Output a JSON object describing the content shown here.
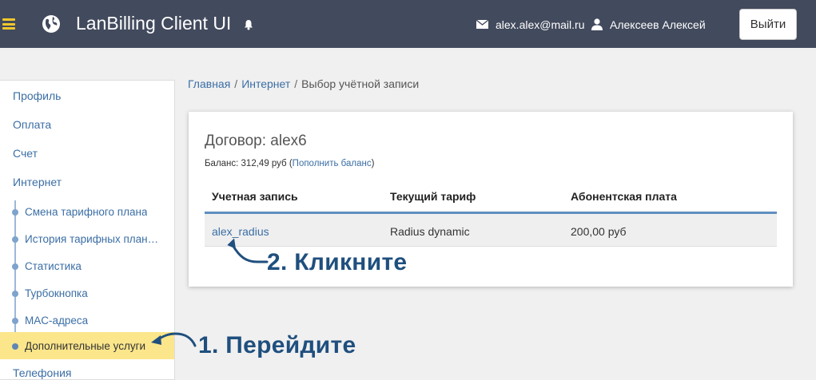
{
  "header": {
    "app_title": "LanBilling Client UI",
    "email": "alex.alex@mail.ru",
    "username": "Алексеев Алексей",
    "logout_label": "Выйти",
    "accent_color": "#f3c82a",
    "bg_color": "#424a5d"
  },
  "sidebar": {
    "items": [
      {
        "label": "Профиль"
      },
      {
        "label": "Оплата"
      },
      {
        "label": "Счет"
      },
      {
        "label": "Интернет"
      }
    ],
    "sub_items": [
      {
        "label": "Смена тарифного плана"
      },
      {
        "label": "История тарифных плана..."
      },
      {
        "label": "Статистика"
      },
      {
        "label": "Турбокнопка"
      },
      {
        "label": "MAC-адреса"
      },
      {
        "label": "Дополнительные услуги",
        "active": true
      }
    ],
    "bottom_item": {
      "label": "Телефония"
    }
  },
  "breadcrumb": {
    "home": "Главная",
    "section": "Интернет",
    "current": "Выбор учётной записи",
    "separator": "/"
  },
  "card": {
    "contract_title": "Договор: alex6",
    "balance_label": "Баланс: 312,49  руб (",
    "balance_link": "Пополнить баланс",
    "balance_close": ")",
    "columns": [
      "Учетная запись",
      "Текущий тариф",
      "Абонентская плата"
    ],
    "rows": [
      {
        "account": "alex_radius",
        "tariff": "Radius dynamic",
        "fee": "200,00 руб"
      }
    ]
  },
  "annotations": {
    "step1": "1. Перейдите",
    "step2": "2. Кликните",
    "color": "#1f4f7e"
  }
}
